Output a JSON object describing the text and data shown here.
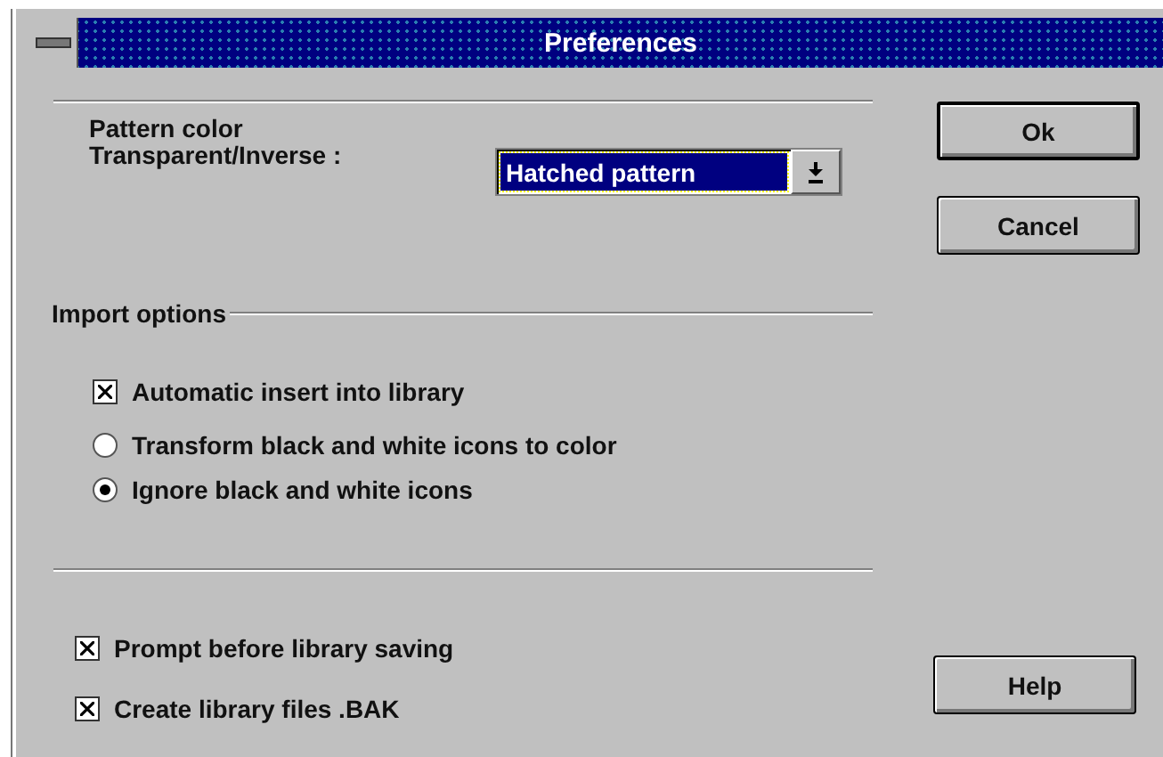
{
  "window": {
    "title": "Preferences"
  },
  "pattern": {
    "label_lines": [
      "Pattern color",
      "Transparent/Inverse :"
    ],
    "dropdown": {
      "value": "Hatched pattern",
      "focused": true
    }
  },
  "import_options": {
    "title": "Import options",
    "items": [
      {
        "kind": "checkbox",
        "label": "Automatic insert into library",
        "checked": true
      },
      {
        "kind": "radio",
        "label": "Transform black and white icons to color",
        "selected": false
      },
      {
        "kind": "radio",
        "label": "Ignore black and white icons",
        "selected": true
      }
    ]
  },
  "library_options": [
    {
      "label": "Prompt before library saving",
      "checked": true
    },
    {
      "label": "Create library files .BAK",
      "checked": true
    }
  ],
  "buttons": [
    {
      "label": "Ok",
      "default": true
    },
    {
      "label": "Cancel",
      "default": false
    }
  ],
  "help_button": {
    "label": "Help"
  }
}
